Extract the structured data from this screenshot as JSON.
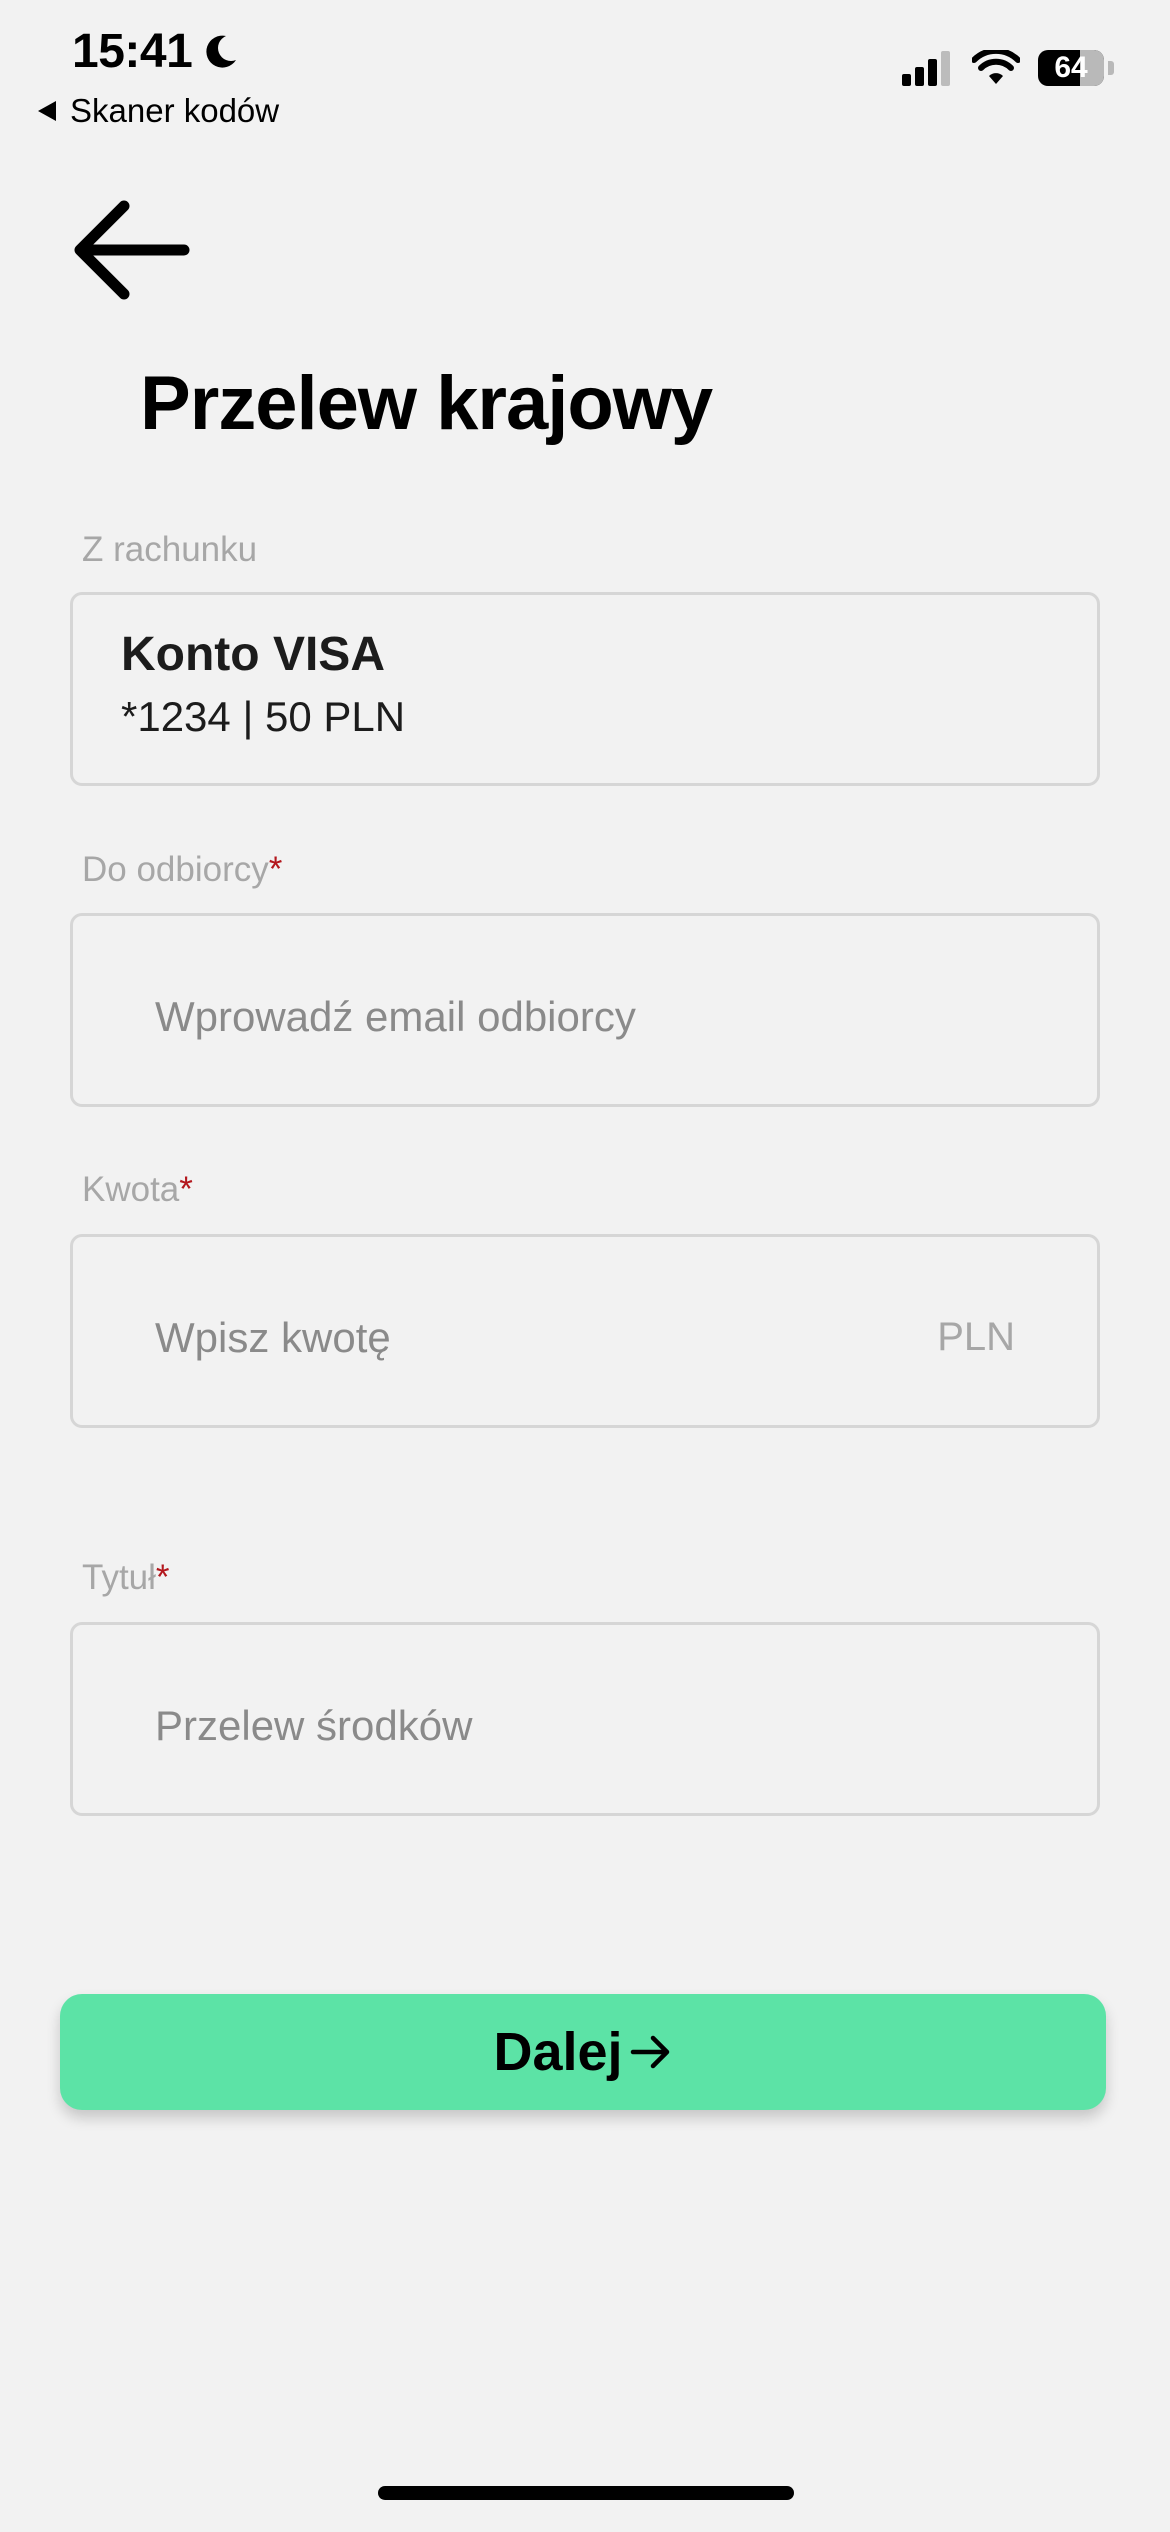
{
  "status_bar": {
    "time": "15:41",
    "back_app": "Skaner kodów",
    "battery": "64"
  },
  "header": {
    "title": "Przelew krajowy"
  },
  "form": {
    "from_account": {
      "label": "Z rachunku",
      "account_name": "Konto VISA",
      "account_detail": "*1234 | 50 PLN"
    },
    "recipient": {
      "label": "Do odbiorcy",
      "required_mark": "*",
      "placeholder": "Wprowadź email odbiorcy"
    },
    "amount": {
      "label": "Kwota",
      "required_mark": "*",
      "placeholder": "Wpisz kwotę",
      "currency": "PLN"
    },
    "title_field": {
      "label": "Tytuł",
      "required_mark": "*",
      "placeholder": "Przelew środków"
    }
  },
  "actions": {
    "next_label": "Dalej"
  },
  "colors": {
    "background": "#f2f2f2",
    "accent": "#5ce3a6",
    "required": "#b3171d",
    "label": "#a7a7a7"
  }
}
